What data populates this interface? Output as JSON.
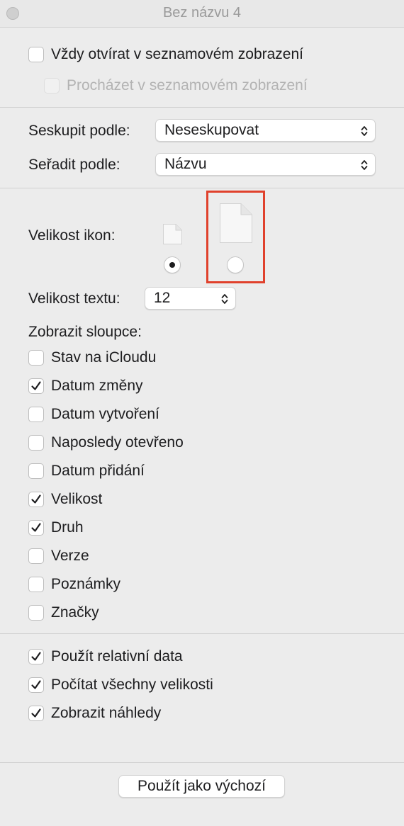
{
  "window": {
    "title": "Bez názvu 4"
  },
  "top_options": {
    "always_list": {
      "label": "Vždy otvírat v seznamovém zobrazení",
      "checked": false
    },
    "browse_list": {
      "label": "Procházet v seznamovém zobrazení",
      "checked": false,
      "disabled": true
    }
  },
  "group_by": {
    "label": "Seskupit podle:",
    "value": "Neseskupovat"
  },
  "sort_by": {
    "label": "Seřadit podle:",
    "value": "Názvu"
  },
  "icon_size": {
    "label": "Velikost ikon:",
    "selected": "small",
    "highlight_color": "#e0412c"
  },
  "text_size": {
    "label": "Velikost textu:",
    "value": "12"
  },
  "columns": {
    "label": "Zobrazit sloupce:",
    "items": [
      {
        "label": "Stav na iCloudu",
        "checked": false
      },
      {
        "label": "Datum změny",
        "checked": true
      },
      {
        "label": "Datum vytvoření",
        "checked": false
      },
      {
        "label": "Naposledy otevřeno",
        "checked": false
      },
      {
        "label": "Datum přidání",
        "checked": false
      },
      {
        "label": "Velikost",
        "checked": true
      },
      {
        "label": "Druh",
        "checked": true
      },
      {
        "label": "Verze",
        "checked": false
      },
      {
        "label": "Poznámky",
        "checked": false
      },
      {
        "label": "Značky",
        "checked": false
      }
    ]
  },
  "bottom_options": [
    {
      "label": "Použít relativní data",
      "checked": true
    },
    {
      "label": "Počítat všechny velikosti",
      "checked": true
    },
    {
      "label": "Zobrazit náhledy",
      "checked": true
    }
  ],
  "default_button": {
    "label": "Použít jako výchozí"
  }
}
